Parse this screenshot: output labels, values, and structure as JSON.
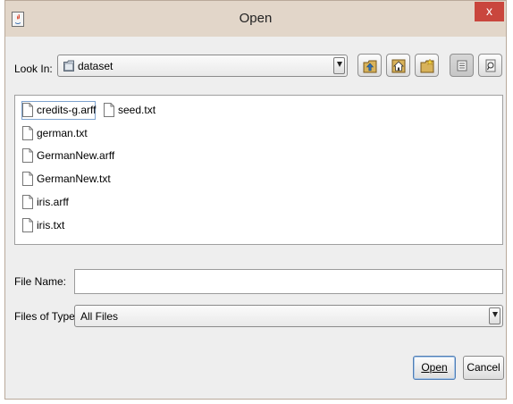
{
  "window": {
    "title": "Open",
    "close_label": "x"
  },
  "look_in": {
    "label": "Look In:",
    "value": "dataset"
  },
  "toolbar": {
    "buttons": [
      {
        "name": "up-one-level-button",
        "icon": "folder-up-icon"
      },
      {
        "name": "home-button",
        "icon": "home-icon"
      },
      {
        "name": "new-folder-button",
        "icon": "new-folder-icon"
      },
      {
        "name": "list-view-button",
        "icon": "list-view-icon"
      },
      {
        "name": "details-view-button",
        "icon": "details-view-icon"
      }
    ]
  },
  "files": [
    {
      "name": "credits-g.arff",
      "selected": true
    },
    {
      "name": "german.txt"
    },
    {
      "name": "GermanNew.arff"
    },
    {
      "name": "GermanNew.txt"
    },
    {
      "name": "iris.arff"
    },
    {
      "name": "iris.txt"
    },
    {
      "name": "seed.txt"
    }
  ],
  "file_name": {
    "label": "File Name:",
    "value": ""
  },
  "files_of_type": {
    "label": "Files of Type:",
    "value": "All Files"
  },
  "buttons": {
    "open": "Open",
    "cancel": "Cancel"
  }
}
